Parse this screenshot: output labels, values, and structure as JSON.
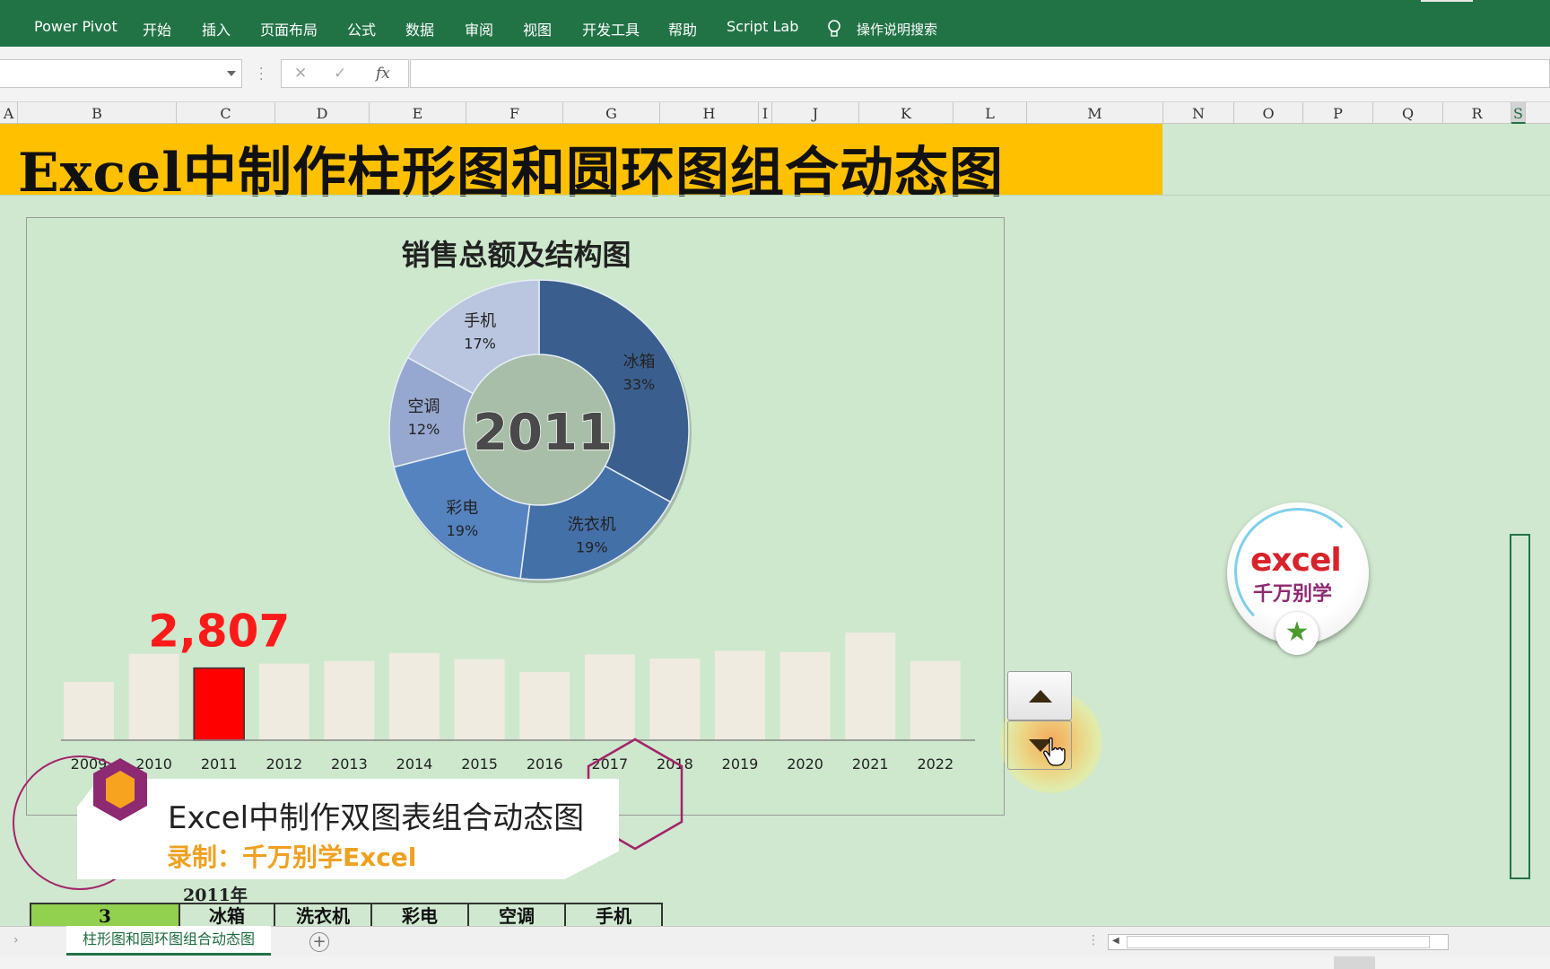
{
  "ribbon": {
    "tabs": [
      "Power Pivot",
      "开始",
      "插入",
      "页面布局",
      "公式",
      "数据",
      "审阅",
      "视图",
      "开发工具",
      "帮助",
      "Script Lab"
    ],
    "search_label": "操作说明搜索"
  },
  "formula_bar": {
    "name_box_value": "",
    "cancel_label": "✕",
    "enter_label": "✓",
    "fx_label": "fx",
    "formula_value": ""
  },
  "columns": [
    "A",
    "B",
    "C",
    "D",
    "E",
    "F",
    "G",
    "H",
    "I",
    "J",
    "K",
    "L",
    "M",
    "N",
    "O",
    "P",
    "Q",
    "R",
    "S"
  ],
  "selected_column": "S",
  "banner_title": "Excel中制作柱形图和圆环图组合动态图",
  "chart_data": [
    {
      "type": "donut",
      "title": "销售总额及结构图",
      "center_label": "2011",
      "slices": [
        {
          "name": "冰箱",
          "label": "33%",
          "value": 33
        },
        {
          "name": "洗衣机",
          "label": "19%",
          "value": 19
        },
        {
          "name": "彩电",
          "label": "19%",
          "value": 19
        },
        {
          "name": "空调",
          "label": "12%",
          "value": 12
        },
        {
          "name": "手机",
          "label": "17%",
          "value": 17
        }
      ],
      "colors": [
        "#3a5f8e",
        "#4470a8",
        "#5583c0",
        "#96a8d0",
        "#bac6e0"
      ]
    },
    {
      "type": "bar",
      "categories": [
        "2009",
        "2010",
        "2011",
        "2012",
        "2013",
        "2014",
        "2015",
        "2016",
        "2017",
        "2018",
        "2019",
        "2020",
        "2021",
        "2022"
      ],
      "values": [
        2270,
        3360,
        2807,
        2980,
        3080,
        3390,
        3160,
        2650,
        3340,
        3180,
        3480,
        3440,
        4190,
        3080
      ],
      "highlight_index": 2,
      "highlight_label": "2,807",
      "bar_color": "#efebe0",
      "highlight_color": "#ff0000",
      "ylim": [
        0,
        4400
      ]
    }
  ],
  "spin_buttons": {
    "up": "▲",
    "down": "▼"
  },
  "logo": {
    "line1": "excel",
    "line2": "千万别学"
  },
  "caption": {
    "line1": "Excel中制作双图表组合动态图",
    "line2": "录制：千万别学Excel"
  },
  "year_label": "2011年",
  "table_row": [
    "3",
    "冰箱",
    "洗衣机",
    "彩电",
    "空调",
    "手机"
  ],
  "sheet_tab": "柱形图和圆环图组合动态图",
  "add_sheet_label": "+"
}
